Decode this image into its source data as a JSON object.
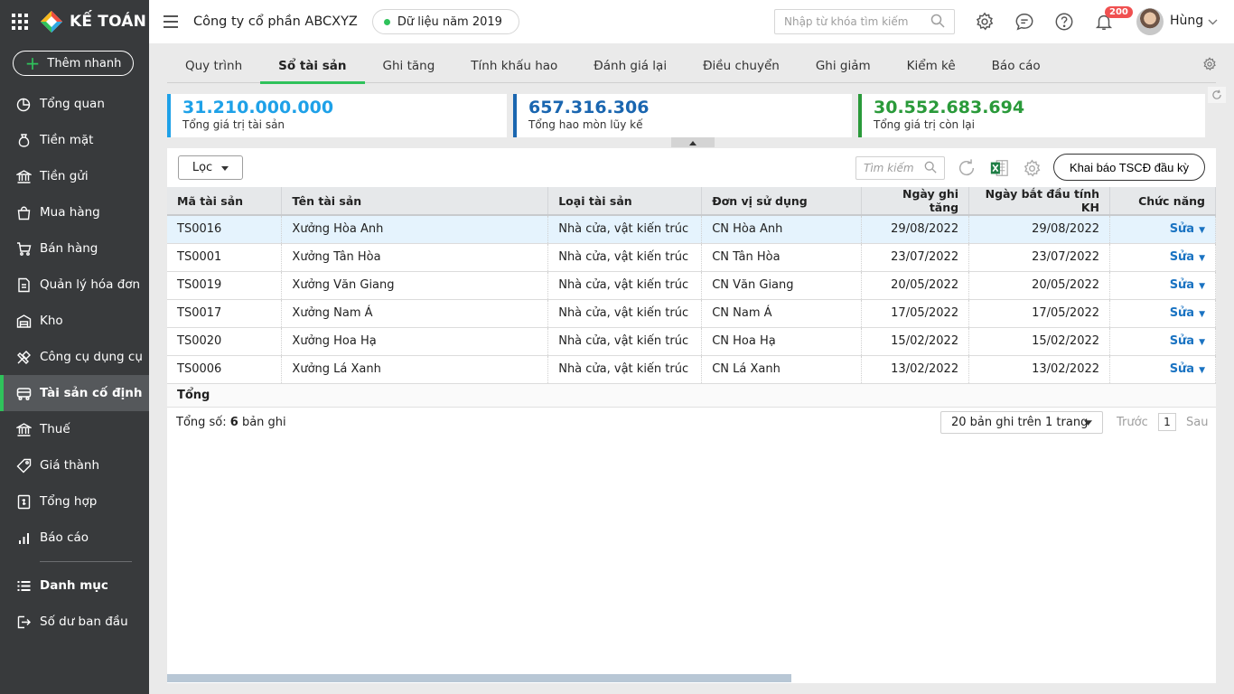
{
  "app": {
    "brand": "KẾ TOÁN",
    "quick_add": "Thêm nhanh"
  },
  "sidebar": {
    "items": [
      {
        "label": "Tổng quan",
        "icon": "pie-chart-icon"
      },
      {
        "label": "Tiền mặt",
        "icon": "money-bag-icon"
      },
      {
        "label": "Tiền gửi",
        "icon": "bank-icon"
      },
      {
        "label": "Mua hàng",
        "icon": "shopping-bag-icon"
      },
      {
        "label": "Bán hàng",
        "icon": "cart-icon"
      },
      {
        "label": "Quản lý hóa đơn",
        "icon": "invoice-icon"
      },
      {
        "label": "Kho",
        "icon": "warehouse-icon"
      },
      {
        "label": "Công cụ dụng cụ",
        "icon": "tools-icon"
      },
      {
        "label": "Tài sản cố định",
        "icon": "truck-icon"
      },
      {
        "label": "Thuế",
        "icon": "tax-icon"
      },
      {
        "label": "Giá thành",
        "icon": "price-tag-icon"
      },
      {
        "label": "Tổng hợp",
        "icon": "ledger-icon"
      },
      {
        "label": "Báo cáo",
        "icon": "bar-chart-icon"
      }
    ],
    "active_index": 8,
    "secondary": [
      {
        "label": "Danh mục",
        "icon": "list-icon"
      },
      {
        "label": "Số dư ban đầu",
        "icon": "login-icon"
      }
    ]
  },
  "header": {
    "company": "Công ty cổ phần ABCXYZ",
    "data_year": "Dữ liệu năm 2019",
    "search_placeholder": "Nhập từ khóa tìm kiếm",
    "notification_count": "200",
    "user_name": "Hùng"
  },
  "tabs": [
    "Quy trình",
    "Sổ tài sản",
    "Ghi tăng",
    "Tính khấu hao",
    "Đánh giá lại",
    "Điều chuyển",
    "Ghi giảm",
    "Kiểm kê",
    "Báo cáo"
  ],
  "active_tab": "Sổ tài sản",
  "summary": [
    {
      "value": "31.210.000.000",
      "label": "Tổng giá trị tài sản",
      "color": "#1ea1e8"
    },
    {
      "value": "657.316.306",
      "label": "Tổng hao mòn lũy kế",
      "color": "#1a66b0"
    },
    {
      "value": "30.552.683.694",
      "label": "Tổng giá trị còn lại",
      "color": "#2a9a3a"
    }
  ],
  "toolbar": {
    "filter_label": "Lọc",
    "search_placeholder": "Tìm kiếm",
    "declare_button": "Khai báo TSCĐ đầu kỳ"
  },
  "table": {
    "columns": [
      "Mã tài sản",
      "Tên tài sản",
      "Loại tài sản",
      "Đơn vị sử  dụng",
      "Ngày ghi tăng",
      "Ngày bắt đầu tính KH",
      "Chức năng"
    ],
    "rows": [
      {
        "code": "TS0016",
        "name": "Xưởng Hòa Anh",
        "type": "Nhà cửa, vật kiến trúc",
        "unit": "CN Hòa Anh",
        "date_add": "29/08/2022",
        "date_dep": "29/08/2022",
        "action": "Sửa"
      },
      {
        "code": "TS0001",
        "name": "Xưởng Tân Hòa",
        "type": "Nhà cửa, vật kiến trúc",
        "unit": "CN Tân Hòa",
        "date_add": "23/07/2022",
        "date_dep": "23/07/2022",
        "action": "Sửa"
      },
      {
        "code": "TS0019",
        "name": "Xưởng Văn Giang",
        "type": "Nhà cửa, vật kiến trúc",
        "unit": "CN Văn Giang",
        "date_add": "20/05/2022",
        "date_dep": "20/05/2022",
        "action": "Sửa"
      },
      {
        "code": "TS0017",
        "name": "Xưởng Nam Á",
        "type": "Nhà cửa, vật kiến trúc",
        "unit": "CN Nam Á",
        "date_add": "17/05/2022",
        "date_dep": "17/05/2022",
        "action": "Sửa"
      },
      {
        "code": "TS0020",
        "name": "Xưởng Hoa Hạ",
        "type": "Nhà cửa, vật kiến trúc",
        "unit": "CN Hoa Hạ",
        "date_add": "15/02/2022",
        "date_dep": "15/02/2022",
        "action": "Sửa"
      },
      {
        "code": "TS0006",
        "name": "Xưởng Lá Xanh",
        "type": "Nhà cửa, vật kiến trúc",
        "unit": "CN Lá Xanh",
        "date_add": "13/02/2022",
        "date_dep": "13/02/2022",
        "action": "Sửa"
      }
    ],
    "selected_row": 0,
    "total_label": "Tổng"
  },
  "footer": {
    "total_prefix": "Tổng số: ",
    "total_count": "6",
    "total_suffix": " bản ghi",
    "page_size": "20 bản ghi trên 1 trang",
    "prev": "Trước",
    "page": "1",
    "next": "Sau"
  },
  "colors": {
    "sidebar_bg": "#383a3c",
    "accent_green": "#2fc25b",
    "link_blue": "#1a73c2"
  }
}
